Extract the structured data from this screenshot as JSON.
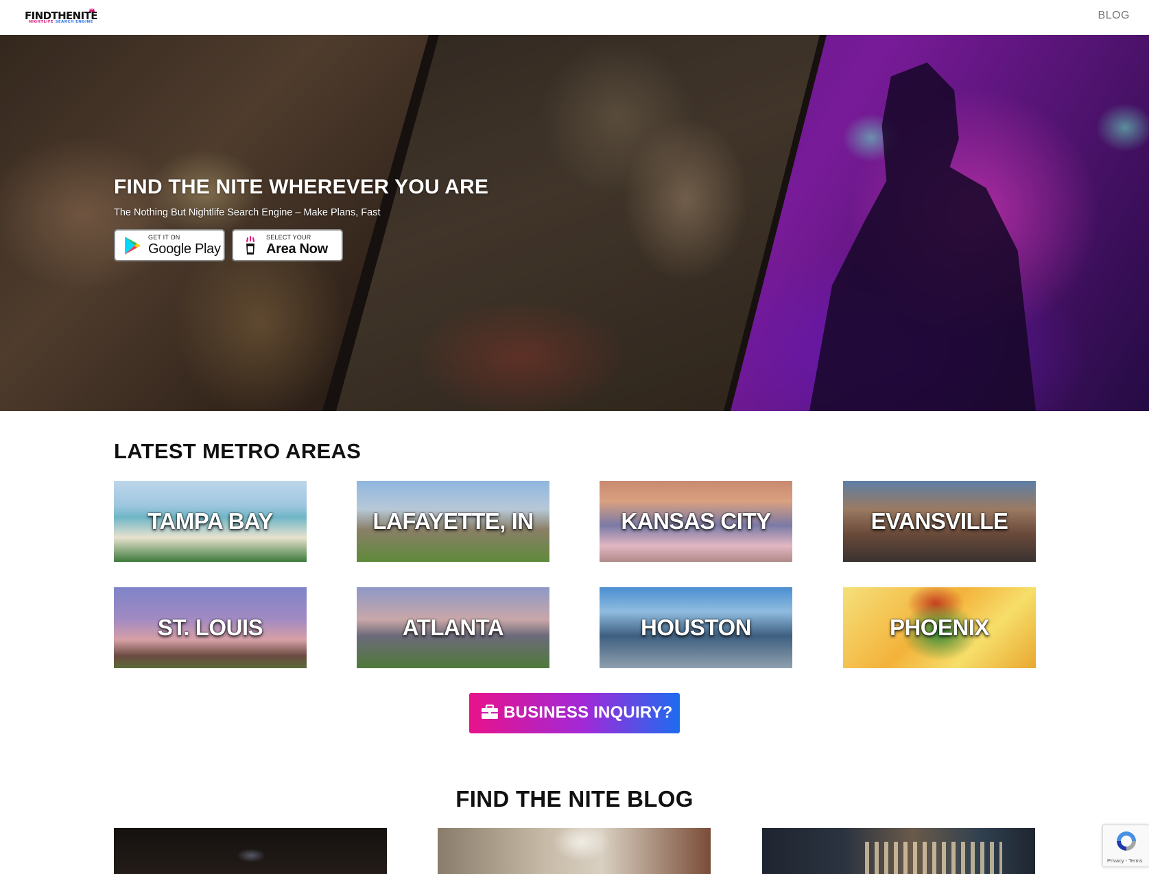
{
  "header": {
    "logo_text": "FINDTHENITE",
    "logo_sub_pink": "NIGHTLIFE",
    "logo_sub_blue": "SEARCH ENGINE",
    "nav_blog": "BLOG"
  },
  "hero": {
    "title": "FIND THE NITE WHEREVER YOU ARE",
    "subtitle": "The Nothing But Nightlife Search Engine – Make Plans, Fast",
    "google_play": {
      "small": "GET IT ON",
      "big": "Google Play"
    },
    "area_button": {
      "small": "SELECT YOUR",
      "big": "Area Now"
    }
  },
  "metro": {
    "title": "LATEST METRO AREAS",
    "areas": [
      "TAMPA BAY",
      "LAFAYETTE, IN",
      "KANSAS CITY",
      "EVANSVILLE",
      "ST. LOUIS",
      "ATLANTA",
      "HOUSTON",
      "PHOENIX"
    ]
  },
  "inquiry": {
    "label": "BUSINESS INQUIRY?",
    "icon": "briefcase-icon"
  },
  "blog": {
    "title": "FIND THE NITE BLOG"
  },
  "recaptcha": {
    "text": "Privacy - Terms"
  },
  "colors": {
    "brand_pink": "#e8128a",
    "brand_purple": "#a02ad8",
    "brand_blue": "#1e6cf0",
    "nav_text": "#777777"
  }
}
